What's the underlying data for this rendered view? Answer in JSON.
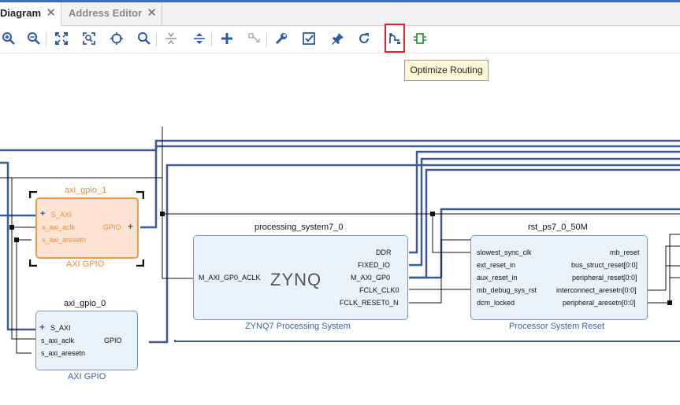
{
  "tabs": [
    {
      "label": "Diagram",
      "close": "✕"
    },
    {
      "label": "Address Editor",
      "close": "✕"
    }
  ],
  "toolbar": {
    "buttons": [
      {
        "name": "zoom-in-icon",
        "icon": "zoom-in"
      },
      {
        "name": "zoom-out-icon",
        "icon": "zoom-out"
      },
      {
        "name": "zoom-fit-icon",
        "icon": "fit"
      },
      {
        "name": "zoom-selection-icon",
        "icon": "fit-selection"
      },
      {
        "name": "autofit-icon",
        "icon": "crosshair"
      },
      {
        "name": "search-icon",
        "icon": "search"
      },
      {
        "name": "collapse-icon",
        "icon": "collapse"
      },
      {
        "name": "expand-icon",
        "icon": "expand"
      },
      {
        "name": "add-ip-icon",
        "icon": "plus"
      },
      {
        "name": "make-connection-icon",
        "icon": "connect"
      },
      {
        "name": "properties-icon",
        "icon": "wrench"
      },
      {
        "name": "validate-icon",
        "icon": "check"
      },
      {
        "name": "pin-icon",
        "icon": "pin"
      },
      {
        "name": "regenerate-layout-icon",
        "icon": "refresh"
      },
      {
        "name": "optimize-routing-icon",
        "icon": "route"
      },
      {
        "name": "default-view-icon",
        "icon": "chip"
      }
    ]
  },
  "tooltip": "Optimize Routing",
  "blocks": {
    "axi_gpio_1": {
      "title": "axi_gpio_1",
      "subtitle": "AXI GPIO",
      "ports_in": [
        "S_AXI",
        "s_axi_aclk",
        "s_axi_aresetn"
      ],
      "port_out": "GPIO"
    },
    "axi_gpio_0": {
      "title": "axi_gpio_0",
      "subtitle": "AXI GPIO",
      "ports_in": [
        "S_AXI",
        "s_axi_aclk",
        "s_axi_aresetn"
      ],
      "port_out": "GPIO"
    },
    "ps7": {
      "title": "processing_system7_0",
      "subtitle": "ZYNQ7 Processing System",
      "logo": "ZYNQ",
      "port_in": "M_AXI_GP0_ACLK",
      "ports_out": [
        "DDR",
        "FIXED_IO",
        "M_AXI_GP0",
        "FCLK_CLK0",
        "FCLK_RESET0_N"
      ]
    },
    "rst": {
      "title": "rst_ps7_0_50M",
      "subtitle": "Processor System Reset",
      "ports_in": [
        "slowest_sync_clk",
        "ext_reset_in",
        "aux_reset_in",
        "mb_debug_sys_rst",
        "dcm_locked"
      ],
      "ports_out": [
        "mb_reset",
        "bus_struct_reset[0:0]",
        "peripheral_reset[0:0]",
        "interconnect_aresetn[0:0]",
        "peripheral_aresetn[0:0]"
      ]
    }
  },
  "colors": {
    "wire": "#3d5a96",
    "accent": "#3f6db5",
    "selected_fill": "#fde3d2",
    "selected_border": "#f09a49",
    "block_fill": "#eaf2fc",
    "highlight": "#e0262a"
  }
}
